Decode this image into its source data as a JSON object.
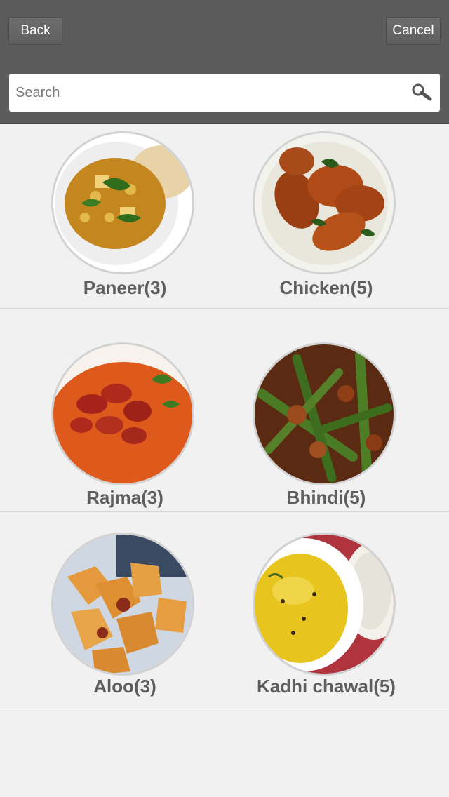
{
  "header": {
    "back_label": "Back",
    "cancel_label": "Cancel"
  },
  "search": {
    "placeholder": "Search"
  },
  "categories": [
    {
      "label": "Paneer(3)",
      "image": "paneer-dish"
    },
    {
      "label": "Chicken(5)",
      "image": "chicken-dish"
    },
    {
      "label": "Rajma(3)",
      "image": "rajma-dish"
    },
    {
      "label": "Bhindi(5)",
      "image": "bhindi-dish"
    },
    {
      "label": "Aloo(3)",
      "image": "aloo-dish"
    },
    {
      "label": "Kadhi chawal(5)",
      "image": "kadhi-chawal-dish"
    }
  ]
}
